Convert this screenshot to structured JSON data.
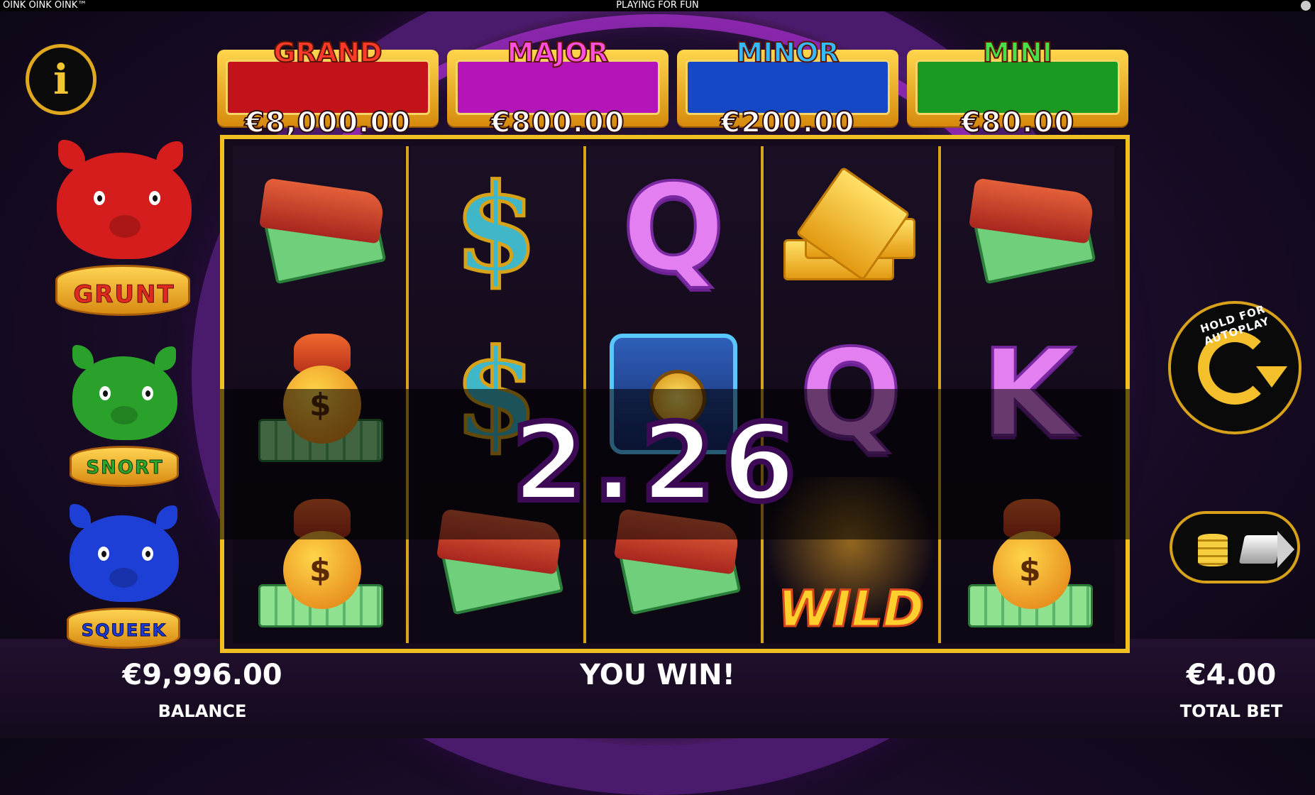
{
  "topbar": {
    "game_name": "OINK OINK OINK™",
    "mode": "PLAYING FOR FUN"
  },
  "info_button": {
    "label": "i"
  },
  "pigs": [
    {
      "label": "GRUNT",
      "color": "#d61d1d"
    },
    {
      "label": "SNORT",
      "color": "#2aa12a"
    },
    {
      "label": "SQUEEK",
      "color": "#1d3fd6"
    }
  ],
  "jackpots": [
    {
      "title": "GRAND",
      "value": "€8,000.00",
      "title_color": "#ff3a2a",
      "panel_color": "#c4121b"
    },
    {
      "title": "MAJOR",
      "value": "€800.00",
      "title_color": "#ff4fe0",
      "panel_color": "#b514b8"
    },
    {
      "title": "MINOR",
      "value": "€200.00",
      "title_color": "#35b9ff",
      "panel_color": "#1448c4"
    },
    {
      "title": "MINI",
      "value": "€80.00",
      "title_color": "#45e04a",
      "panel_color": "#1a9a20"
    }
  ],
  "reels": [
    [
      "wallet",
      "money-bag",
      "money-bag"
    ],
    [
      "dollar",
      "dollar",
      "wallet"
    ],
    [
      "Q",
      "vault",
      "wallet"
    ],
    [
      "gold-bars",
      "Q",
      "wild"
    ],
    [
      "wallet",
      "K",
      "money-bag"
    ]
  ],
  "wild_label": "WILD",
  "win_amount": "2.26",
  "autoplay_label": "HOLD FOR AUTOPLAY",
  "balance": {
    "value": "€9,996.00",
    "label": "BALANCE"
  },
  "win_message": "YOU WIN!",
  "total_bet": {
    "value": "€4.00",
    "label": "TOTAL BET"
  }
}
